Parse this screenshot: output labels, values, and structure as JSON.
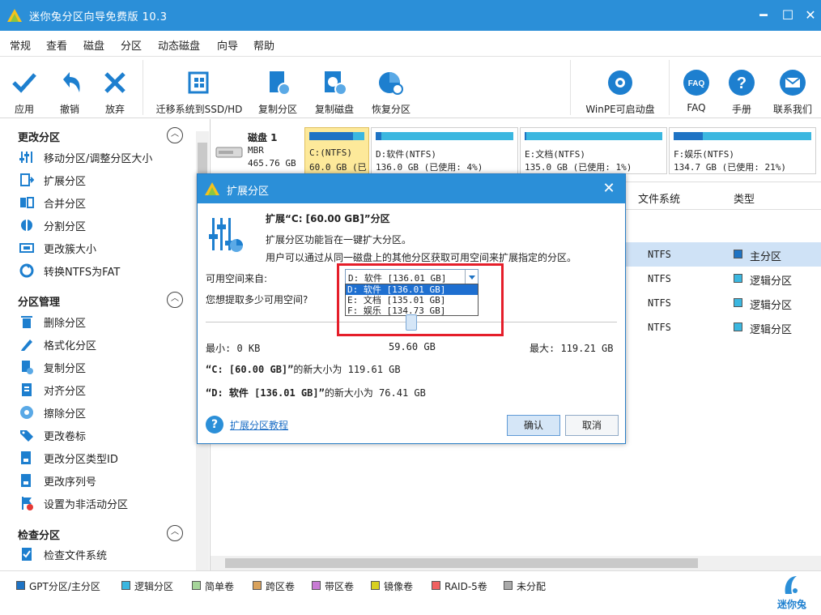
{
  "window": {
    "title": "迷你兔分区向导免费版 10.3",
    "minimize": "━",
    "maximize": "☐",
    "close": "✕"
  },
  "menu": [
    "常规",
    "查看",
    "磁盘",
    "分区",
    "动态磁盘",
    "向导",
    "帮助"
  ],
  "toolbar": {
    "apply": "应用",
    "undo": "撤销",
    "discard": "放弃",
    "migrate": "迁移系统到SSD/HD",
    "copy_partition": "复制分区",
    "copy_disk": "复制磁盘",
    "recover": "恢复分区",
    "winpe": "WinPE可启动盘",
    "faq": "FAQ",
    "manual": "手册",
    "contact": "联系我们",
    "faq_icon_text": "FAQ"
  },
  "sidebar": {
    "change_section": {
      "title": "更改分区",
      "toggle": "︿",
      "items": [
        "移动分区/调整分区大小",
        "扩展分区",
        "合并分区",
        "分割分区",
        "更改簇大小",
        "转换NTFS为FAT"
      ]
    },
    "manage_section": {
      "title": "分区管理",
      "toggle": "︿",
      "items": [
        "删除分区",
        "格式化分区",
        "复制分区",
        "对齐分区",
        "擦除分区",
        "更改卷标",
        "更改分区类型ID",
        "更改序列号",
        "设置为非活动分区"
      ]
    },
    "check_section": {
      "title": "检查分区",
      "toggle": "︿",
      "items": [
        "检查文件系统"
      ]
    }
  },
  "disk": {
    "name": "磁盘 1",
    "type": "MBR",
    "size": "465.76 GB"
  },
  "partitions": [
    {
      "label": "C:(NTFS)",
      "info": "60.0 GB (已",
      "used_pct": 80
    },
    {
      "label": "D:软件(NTFS)",
      "info": "136.0 GB (已使用: 4%)",
      "used_pct": 4
    },
    {
      "label": "E:文档(NTFS)",
      "info": "135.0 GB (已使用: 1%)",
      "used_pct": 1
    },
    {
      "label": "F:娱乐(NTFS)",
      "info": "134.7 GB (已使用: 21%)",
      "used_pct": 21
    }
  ],
  "grid": {
    "columns": {
      "fs": "文件系统",
      "type": "类型"
    },
    "rows": [
      {
        "fs": "NTFS",
        "type": "主分区",
        "color": "#1e73c4"
      },
      {
        "fs": "NTFS",
        "type": "逻辑分区",
        "color": "#3bb7e0"
      },
      {
        "fs": "NTFS",
        "type": "逻辑分区",
        "color": "#3bb7e0"
      },
      {
        "fs": "NTFS",
        "type": "逻辑分区",
        "color": "#3bb7e0"
      }
    ]
  },
  "legend": [
    {
      "label": "GPT分区/主分区",
      "color": "#1e73c4"
    },
    {
      "label": "逻辑分区",
      "color": "#3bb7e0"
    },
    {
      "label": "简单卷",
      "color": "#a6d59a"
    },
    {
      "label": "跨区卷",
      "color": "#d9a25c"
    },
    {
      "label": "带区卷",
      "color": "#c87bd4"
    },
    {
      "label": "镜像卷",
      "color": "#d8d020"
    },
    {
      "label": "RAID-5卷",
      "color": "#f06060"
    },
    {
      "label": "未分配",
      "color": "#aaaaaa"
    }
  ],
  "brand": "迷你兔",
  "dialog": {
    "title": "扩展分区",
    "close": "✕",
    "heading": "扩展“C: [60.00 GB]”分区",
    "desc1": "扩展分区功能旨在一键扩大分区。",
    "desc2": "用户可以通过从同一磁盘上的其他分区获取可用空间来扩展指定的分区。",
    "source_label": "可用空间来自:",
    "amount_label": "您想提取多少可用空间?",
    "combo_value": "D: 软件 [136.01 GB]",
    "options": [
      "D: 软件 [136.01 GB]",
      "E: 文档 [135.01 GB]",
      "F: 娱乐 [134.73 GB]"
    ],
    "slider_fraction": 0.5,
    "min": "最小: 0 KB",
    "mid": "59.60 GB",
    "max": "最大:  119.21 GB",
    "c_new_prefix": "“C: [60.00 GB]”",
    "c_new_suffix": "的新大小为 119.61 GB",
    "d_new_prefix": "“D: 软件 [136.01 GB]”",
    "d_new_suffix": "的新大小为 76.41 GB",
    "help_icon": "?",
    "help_link": "扩展分区教程",
    "ok": "确认",
    "cancel": "取消"
  }
}
